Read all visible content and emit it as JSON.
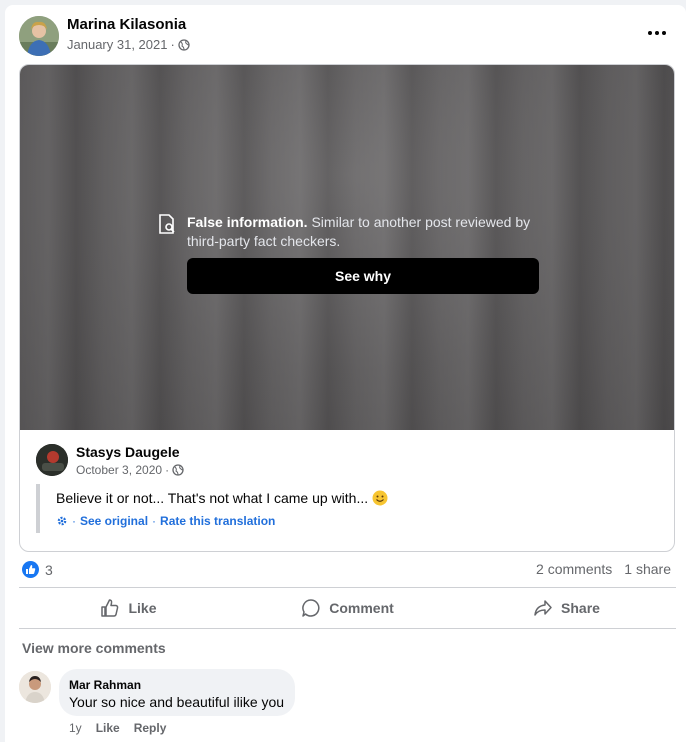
{
  "post": {
    "author": "Marina Kilasonia",
    "date": "January 31, 2021",
    "separator": "·",
    "privacy_icon": "globe-icon",
    "more_icon": "more-dots-icon"
  },
  "shared": {
    "warning_title": "False information.",
    "warning_text": "Similar to another post reviewed by third-party fact checkers.",
    "see_why_label": "See why",
    "author": "Stasys Daugele",
    "date": "October 3, 2020",
    "separator": "·",
    "text": "Believe it or not... That's not what I came up with...",
    "emoji": "smiley-emoji",
    "see_original": "See original",
    "rate_translation": "Rate this translation",
    "dot": "·"
  },
  "reactions": {
    "count": "3",
    "comments": "2 comments",
    "shares": "1 share"
  },
  "actions": {
    "like": "Like",
    "comment": "Comment",
    "share": "Share"
  },
  "comments": {
    "view_more": "View more comments",
    "items": [
      {
        "author": "Mar Rahman",
        "text": "Your so nice and beautiful ilike you",
        "time": "1y",
        "like": "Like",
        "reply": "Reply"
      }
    ]
  },
  "colors": {
    "accent": "#1877f2",
    "link": "#216fdb",
    "muted": "#65676b"
  }
}
